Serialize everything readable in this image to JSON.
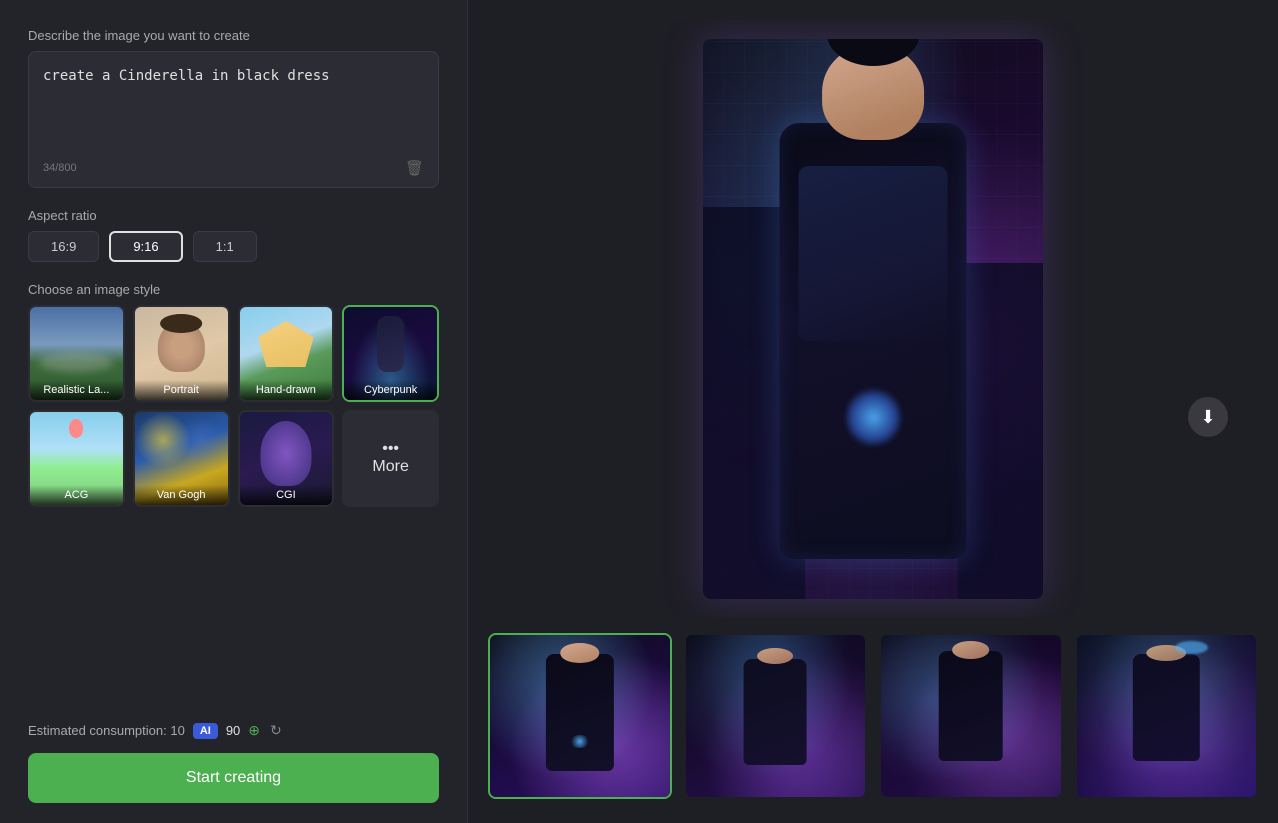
{
  "prompt": {
    "label": "Describe the image you want to create",
    "value": "create a Cinderella in black dress",
    "char_count": "34/800",
    "placeholder": "Describe the image you want to create"
  },
  "aspect_ratio": {
    "label": "Aspect ratio",
    "options": [
      {
        "label": "16:9",
        "active": false
      },
      {
        "label": "9:16",
        "active": true
      },
      {
        "label": "1:1",
        "active": false
      }
    ]
  },
  "image_style": {
    "label": "Choose an image style",
    "styles": [
      {
        "id": "realistic",
        "label": "Realistic La...",
        "active": false
      },
      {
        "id": "portrait",
        "label": "Portrait",
        "active": false
      },
      {
        "id": "hand-drawn",
        "label": "Hand-drawn",
        "active": false
      },
      {
        "id": "cyberpunk",
        "label": "Cyberpunk",
        "active": true
      },
      {
        "id": "acg",
        "label": "ACG",
        "active": false
      },
      {
        "id": "van-gogh",
        "label": "Van Gogh",
        "active": false
      },
      {
        "id": "cgi",
        "label": "CGI",
        "active": false
      },
      {
        "id": "more",
        "label": "More",
        "active": false
      }
    ]
  },
  "footer": {
    "consumption_label": "Estimated consumption: 10",
    "ai_badge": "AI",
    "credits": "90",
    "start_button": "Start creating"
  },
  "main_image": {
    "alt": "Cyberpunk Cinderella in black dress"
  },
  "thumbnails": [
    {
      "id": 1,
      "selected": true,
      "alt": "Generated image 1"
    },
    {
      "id": 2,
      "selected": false,
      "alt": "Generated image 2"
    },
    {
      "id": 3,
      "selected": false,
      "alt": "Generated image 3"
    },
    {
      "id": 4,
      "selected": false,
      "alt": "Generated image 4"
    }
  ],
  "icons": {
    "trash": "🗑",
    "download": "⬇",
    "plus": "⊕",
    "refresh": "↻",
    "dots": "•••"
  }
}
